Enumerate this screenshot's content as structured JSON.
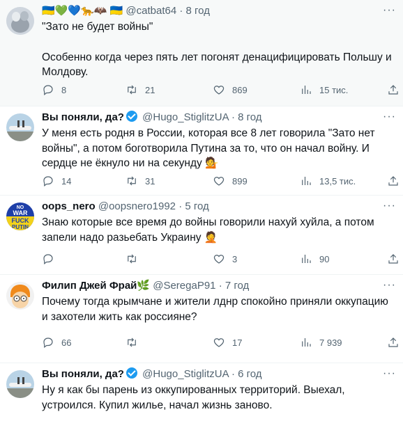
{
  "tweets": [
    {
      "name": "🇺🇦💚💙🐆🦇 🇺🇦",
      "handle": "@catbat64",
      "sep": "·",
      "time": "8 год",
      "verified": false,
      "lines": [
        "\"Зато не будет войны\"",
        "Особенно когда через пять лет погонят денацифицировать Польшу и Молдову."
      ],
      "replies": "8",
      "retweets": "21",
      "likes": "869",
      "views": "15 тис."
    },
    {
      "name": "Вы поняли, да?",
      "handle": "@Hugo_StiglitzUA",
      "sep": "·",
      "time": "8 год",
      "verified": true,
      "lines": [
        "У меня есть родня в России, которая все 8 лет говорила \"Зато нет войны\", а потом боготворила Путина за то, что он начал войну. И сердце не ёкнуло ни на секунду 💁"
      ],
      "replies": "14",
      "retweets": "31",
      "likes": "899",
      "views": "13,5 тис."
    },
    {
      "name": "oops_nero",
      "handle": "@oopsnero1992",
      "sep": "·",
      "time": "5 год",
      "verified": false,
      "avatar_text": [
        "NO",
        "WAR",
        "FUCK",
        "PUTIN"
      ],
      "lines": [
        "Знаю которые все время до войны говорили нахуй хуйла, а потом запели надо разьебать Украину 🤦"
      ],
      "replies": "",
      "retweets": "",
      "likes": "3",
      "views": "90"
    },
    {
      "name": "Филип Джей Фрай🌿",
      "handle": "@SeregaP91",
      "sep": "·",
      "time": "7 год",
      "verified": false,
      "lines": [
        "Почему тогда крымчане и жители лднр спокойно приняли оккупацию и захотели жить как россияне?"
      ],
      "replies": "66",
      "retweets": "",
      "likes": "17",
      "views": "7 939"
    },
    {
      "name": "Вы поняли, да?",
      "handle": "@Hugo_StiglitzUA",
      "sep": "·",
      "time": "6 год",
      "verified": true,
      "lines": [
        "Ну я как бы парень из оккупированных территорий. Выехал, устроился. Купил жилье, начал жизнь заново."
      ]
    }
  ],
  "more_label": "···",
  "colors": {
    "accent": "#1d9bf0",
    "muted": "#536471",
    "text": "#0f1419"
  }
}
